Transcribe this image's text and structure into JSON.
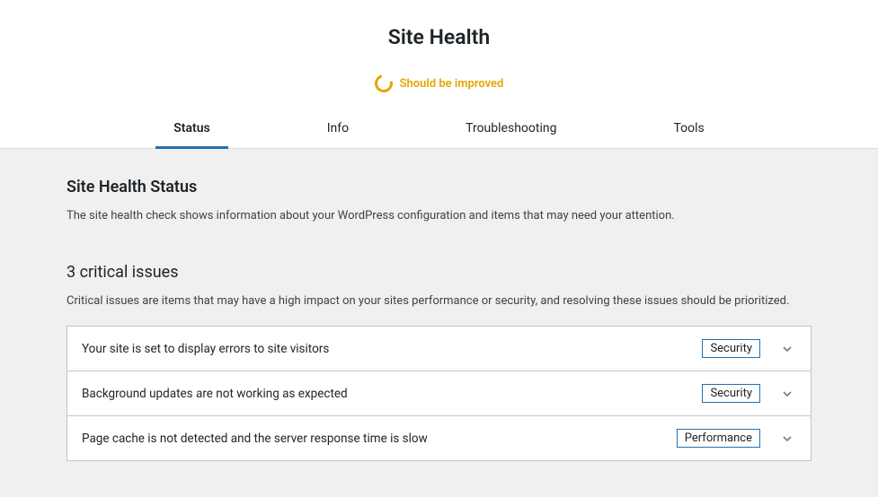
{
  "header": {
    "page_title": "Site Health",
    "indicator_text": "Should be improved"
  },
  "tabs": [
    {
      "label": "Status",
      "active": true
    },
    {
      "label": "Info",
      "active": false
    },
    {
      "label": "Troubleshooting",
      "active": false
    },
    {
      "label": "Tools",
      "active": false
    }
  ],
  "status_section": {
    "heading": "Site Health Status",
    "description": "The site health check shows information about your WordPress configuration and items that may need your attention."
  },
  "critical_issues": {
    "heading": "3 critical issues",
    "description": "Critical issues are items that may have a high impact on your sites performance or security, and resolving these issues should be prioritized.",
    "items": [
      {
        "title": "Your site is set to display errors to site visitors",
        "badge": "Security"
      },
      {
        "title": "Background updates are not working as expected",
        "badge": "Security"
      },
      {
        "title": "Page cache is not detected and the server response time is slow",
        "badge": "Performance"
      }
    ]
  }
}
